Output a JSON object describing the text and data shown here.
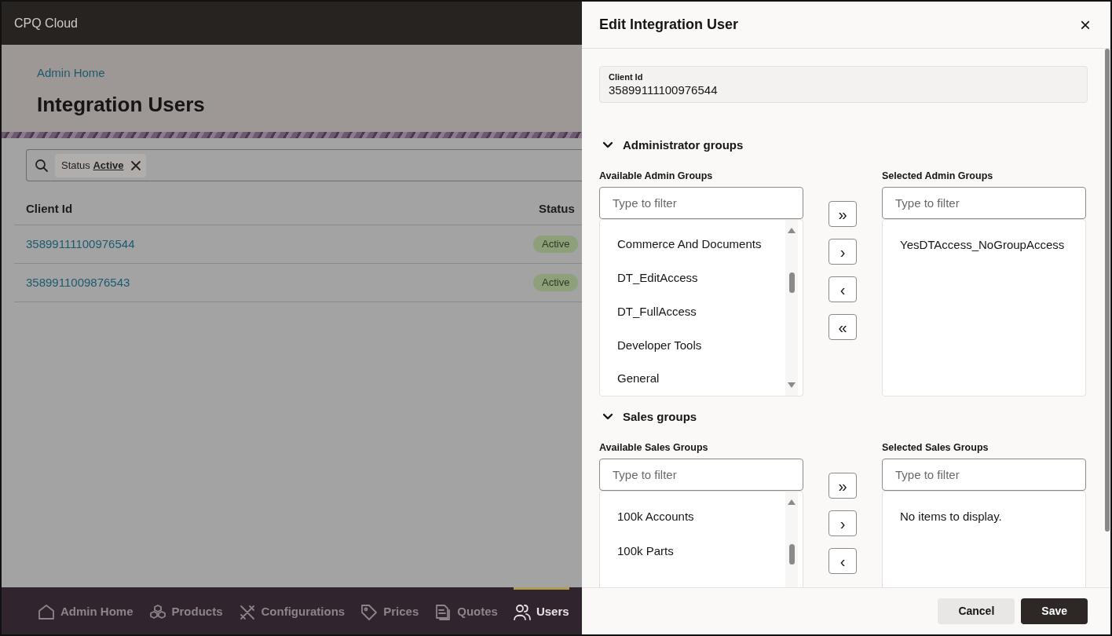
{
  "app": {
    "title": "CPQ Cloud"
  },
  "page": {
    "breadcrumb": "Admin Home",
    "title": "Integration Users",
    "filter_chips": [
      {
        "label": "Status",
        "value": "Active"
      }
    ],
    "table": {
      "columns": [
        "Client Id",
        "Status"
      ],
      "rows": [
        {
          "client_id": "35899111100976544",
          "status": "Active"
        },
        {
          "client_id": "3589911009876543",
          "status": "Active"
        }
      ]
    }
  },
  "bottom_nav": [
    {
      "label": "Admin Home",
      "kind": "home",
      "selected": false
    },
    {
      "label": "Products",
      "kind": "products",
      "selected": false
    },
    {
      "label": "Configurations",
      "kind": "configurations",
      "selected": false
    },
    {
      "label": "Prices",
      "kind": "prices",
      "selected": false
    },
    {
      "label": "Quotes",
      "kind": "quotes",
      "selected": false
    },
    {
      "label": "Users",
      "kind": "users",
      "selected": true
    }
  ],
  "drawer": {
    "title": "Edit Integration User",
    "close": "×",
    "client_id": {
      "label": "Client Id",
      "value": "35899111100976544"
    },
    "sections": [
      {
        "title": "Administrator groups",
        "expanded": true,
        "available": {
          "label": "Available Admin Groups",
          "placeholder": "Type to filter",
          "items": [
            "Commerce And Documents",
            "DT_EditAccess",
            "DT_FullAccess",
            "Developer Tools",
            "General"
          ]
        },
        "shuttle_buttons": [
          "»",
          "›",
          "‹",
          "«"
        ],
        "selected": {
          "label": "Selected Admin Groups",
          "placeholder": "Type to filter",
          "items": [
            "YesDTAccess_NoGroupAccess"
          ]
        }
      },
      {
        "title": "Sales groups",
        "expanded": true,
        "available": {
          "label": "Available Sales Groups",
          "placeholder": "Type to filter",
          "items": [
            "100k Accounts",
            "100k Parts"
          ]
        },
        "shuttle_buttons": [
          "»",
          "›",
          "‹"
        ],
        "selected": {
          "label": "Selected Sales Groups",
          "placeholder": "Type to filter",
          "empty_text": "No items to display."
        }
      }
    ],
    "actions": [
      {
        "label": "Cancel",
        "kind": "secondary"
      },
      {
        "label": "Save",
        "kind": "primary"
      }
    ]
  }
}
